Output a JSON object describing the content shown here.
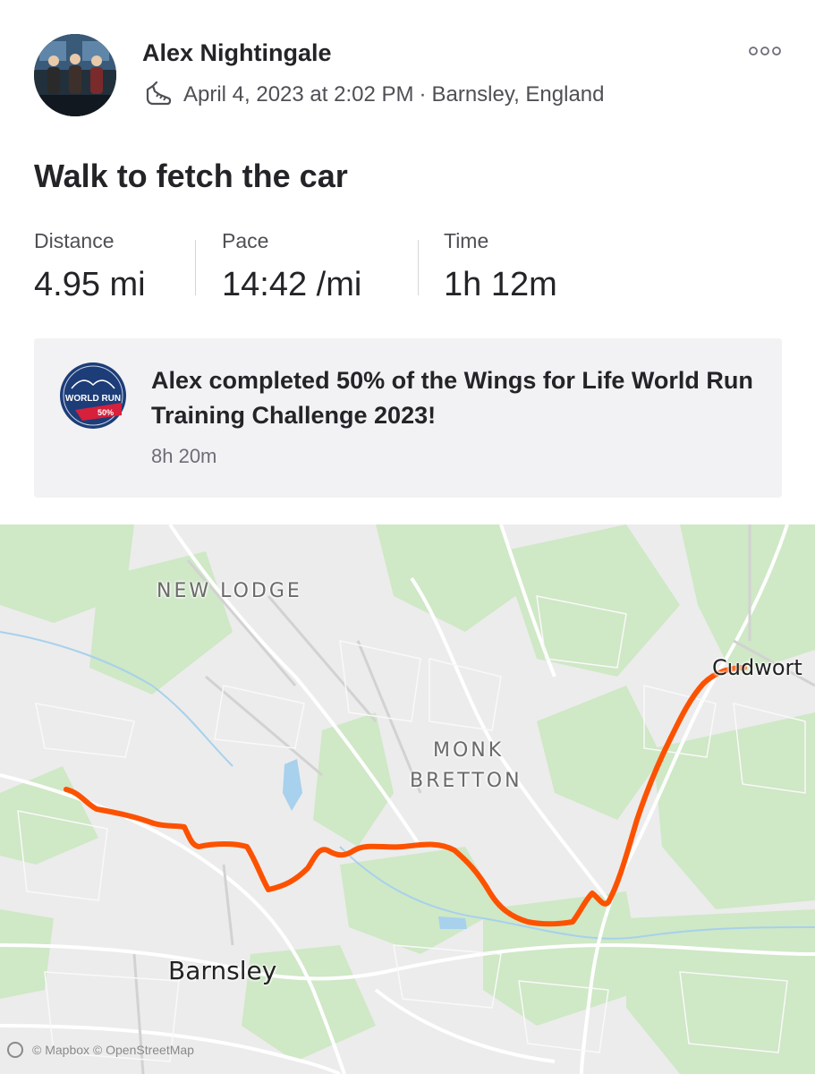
{
  "athlete": {
    "name": "Alex Nightingale"
  },
  "activity": {
    "icon": "walking-shoe-icon",
    "date_time": "April 4, 2023 at 2:02 PM",
    "separator": "·",
    "location": "Barnsley, England",
    "title": "Walk to fetch the car"
  },
  "stats": [
    {
      "label": "Distance",
      "value": "4.95 mi"
    },
    {
      "label": "Pace",
      "value": "14:42 /mi"
    },
    {
      "label": "Time",
      "value": "1h 12m"
    }
  ],
  "challenge": {
    "badge_text_top": "WORLD RUN",
    "badge_text_bottom": "50%",
    "text": "Alex completed 50% of the Wings for Life World Run Training Challenge 2023!",
    "time": "8h 20m"
  },
  "map": {
    "labels": {
      "new_lodge": "NEW LODGE",
      "monk": "MONK",
      "bretton": "BRETTON",
      "cudworth": "Cudwort",
      "barnsley": "Barnsley"
    },
    "attribution": "© Mapbox © OpenStreetMap",
    "route_color": "#fc5200"
  },
  "colors": {
    "accent": "#fc5200",
    "card_bg": "#f2f2f4"
  }
}
